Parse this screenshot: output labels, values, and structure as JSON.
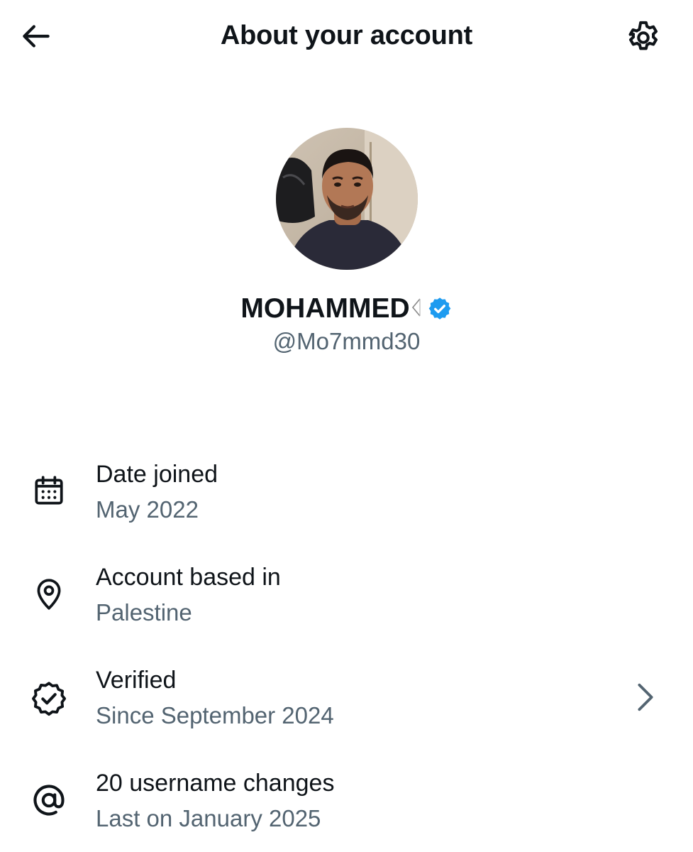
{
  "header": {
    "title": "About your account",
    "back_icon": "arrow-left-icon",
    "settings_icon": "gear-icon"
  },
  "profile": {
    "display_name": "MOHAMMED",
    "name_emoji": "palestine-flag-icon",
    "verified_badge": "verified-badge-icon",
    "handle": "@Mo7mmd30",
    "avatar": "profile-photo"
  },
  "details": [
    {
      "icon": "calendar-icon",
      "label": "Date joined",
      "value": "May 2022"
    },
    {
      "icon": "location-pin-icon",
      "label": "Account based in",
      "value": "Palestine"
    },
    {
      "icon": "verified-check-icon",
      "label": "Verified",
      "value": "Since September 2024",
      "has_chevron": true
    },
    {
      "icon": "at-sign-icon",
      "label": "20 username changes",
      "value": "Last on January 2025"
    }
  ],
  "colors": {
    "primary_text": "#0f1419",
    "secondary_text": "#536471",
    "verified_blue": "#1d9bf0",
    "background": "#ffffff"
  }
}
